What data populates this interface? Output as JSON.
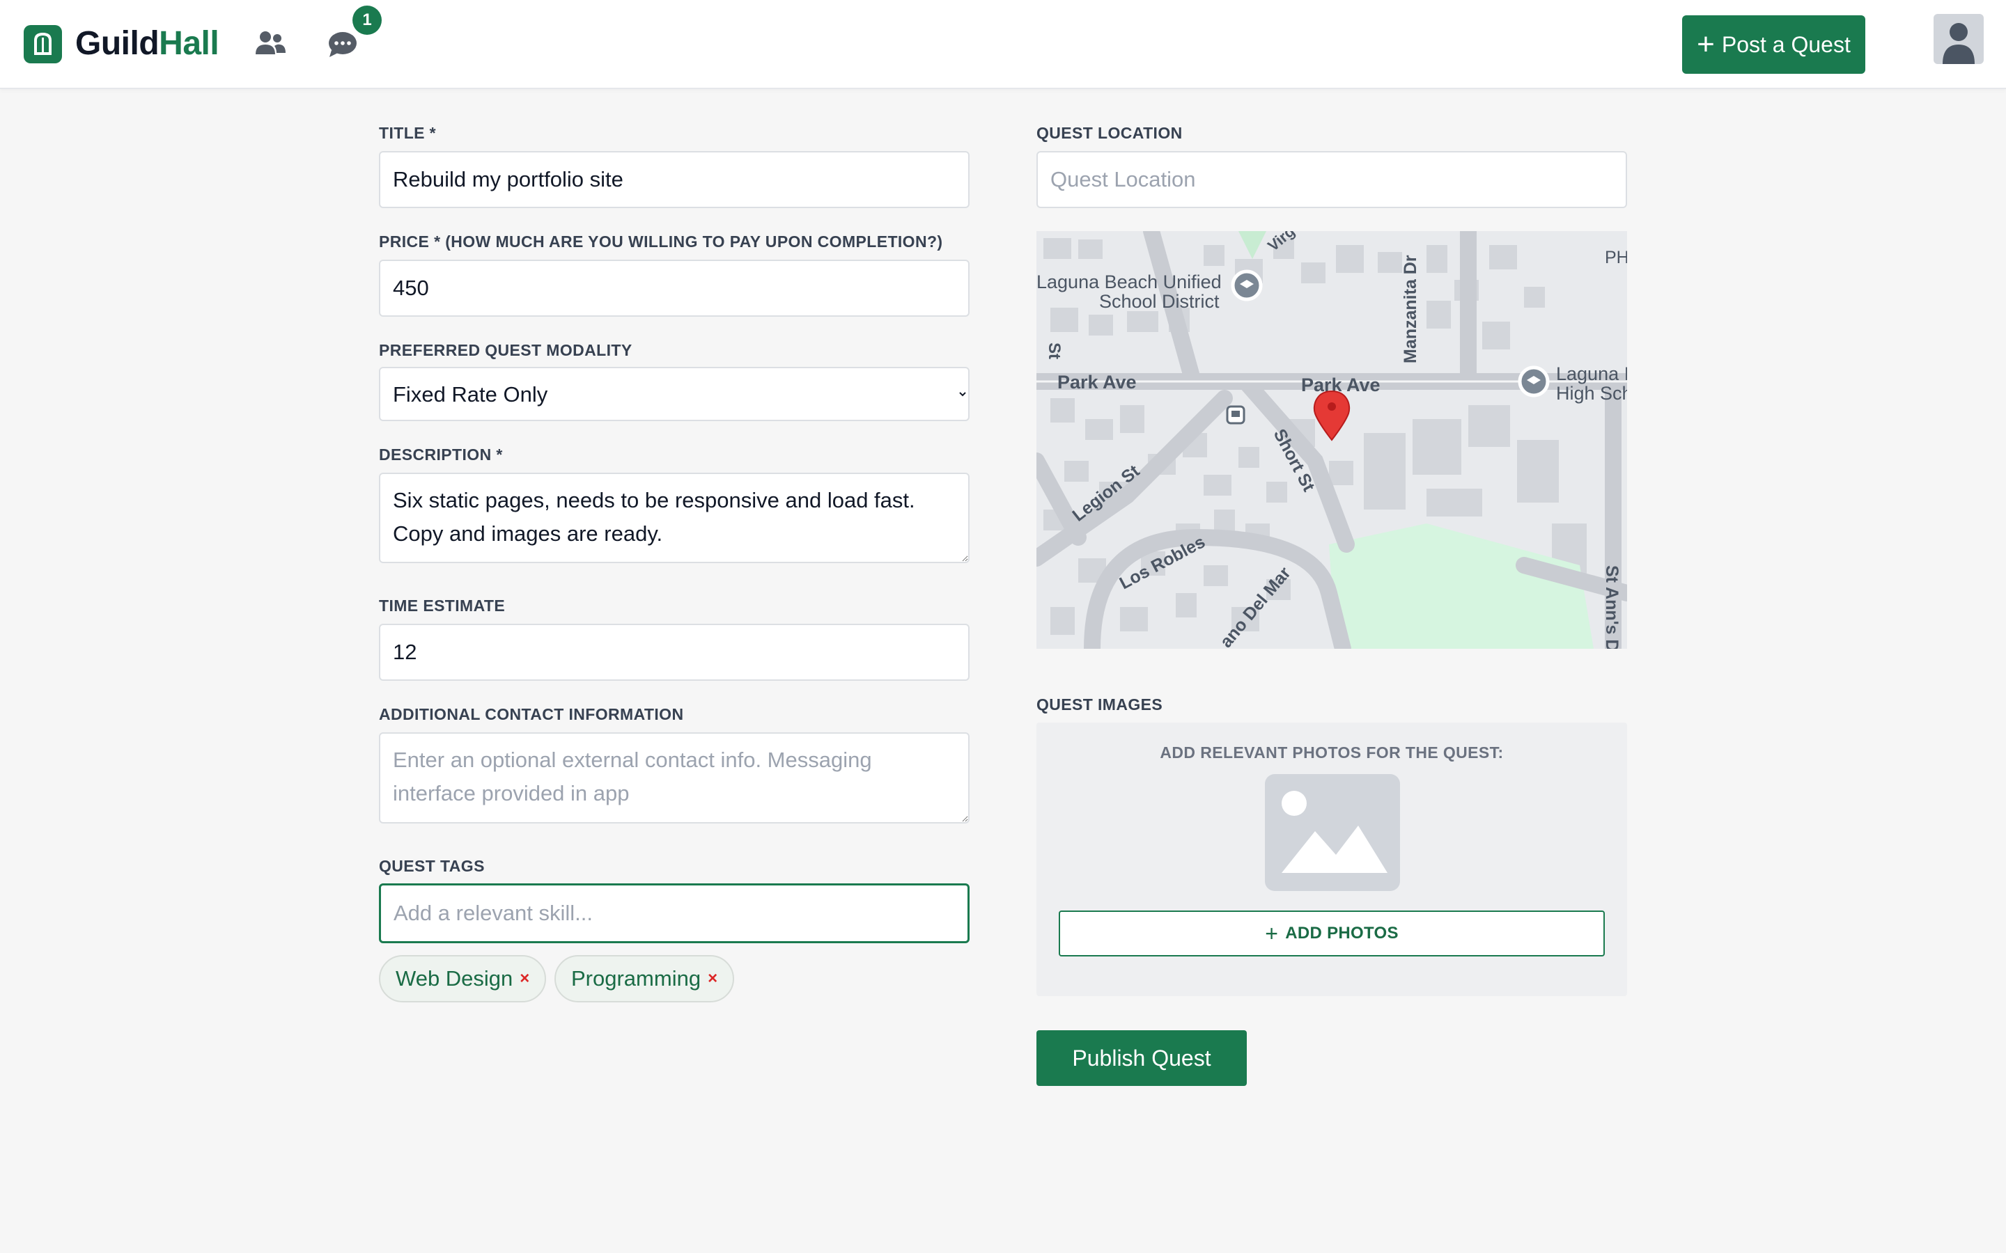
{
  "header": {
    "logo_icon": "guild-hall-building-icon",
    "brand_part1": "Guild",
    "brand_part2": "Hall",
    "users_icon": "users-icon",
    "messages_icon": "chat-bubble-icon",
    "messages_badge": "1",
    "post_button_label": "Post a Quest",
    "avatar_icon": "user-avatar-icon"
  },
  "form": {
    "title": {
      "label": "TITLE *",
      "value": "Rebuild my portfolio site"
    },
    "price": {
      "label": "PRICE * (HOW MUCH ARE YOU WILLING TO PAY UPON COMPLETION?)",
      "value": "450"
    },
    "modality": {
      "label": "PREFERRED QUEST MODALITY",
      "selected": "Fixed Rate Only"
    },
    "description": {
      "label": "DESCRIPTION *",
      "value": "Six static pages, needs to be responsive and load fast. Copy and images are ready."
    },
    "time_estimate": {
      "label": "TIME ESTIMATE",
      "value": "12"
    },
    "contact": {
      "label": "ADDITIONAL CONTACT INFORMATION",
      "placeholder": "Enter an optional external contact info. Messaging interface provided in app"
    },
    "tags": {
      "label": "QUEST TAGS",
      "placeholder": "Add a relevant skill...",
      "items": [
        {
          "label": "Web Design",
          "remove": "×"
        },
        {
          "label": "Programming",
          "remove": "×"
        }
      ]
    },
    "location": {
      "label": "QUEST LOCATION",
      "placeholder": "Quest Location"
    },
    "map": {
      "labels": {
        "school_district_1": "Laguna Beach Unified",
        "school_district_2": "School District",
        "park_ave_left": "Park Ave",
        "park_ave_right": "Park Ave",
        "manzanita": "Manzanita Dr",
        "legion": "Legion St",
        "short": "Short St",
        "los_robles": "Los Robles",
        "del_mar": "ano Del Mar",
        "st_anns": "St Ann's D",
        "high_school_1": "Laguna I",
        "high_school_2": "High Sch",
        "virg": "Virg",
        "ph": "PH",
        "st_left": "St"
      },
      "marker_icon": "map-pin-icon"
    },
    "images": {
      "label": "QUEST IMAGES",
      "hint": "ADD RELEVANT PHOTOS FOR THE QUEST:",
      "placeholder_icon": "image-placeholder-icon",
      "add_button_label": "ADD PHOTOS"
    },
    "publish_label": "Publish Quest"
  },
  "colors": {
    "brand": "#1a7a4f",
    "danger": "#dc2626",
    "page_bg": "#f6f6f6"
  }
}
